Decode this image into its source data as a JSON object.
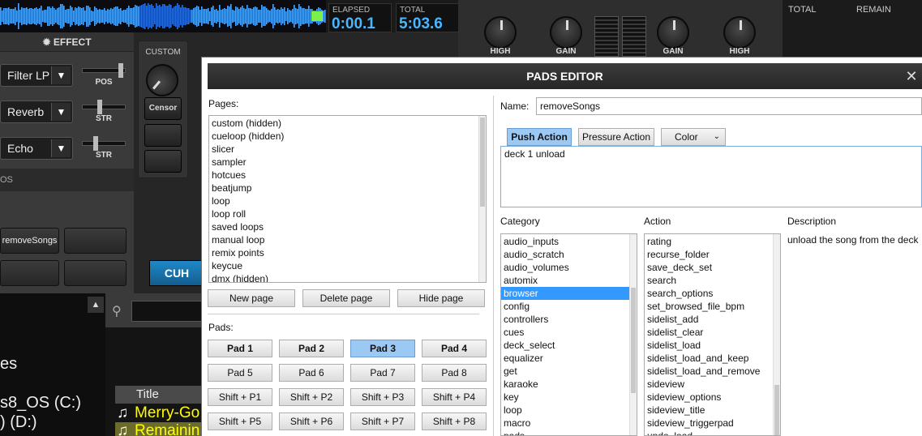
{
  "deck": {
    "elapsed_label": "ELAPSED",
    "elapsed": "0:00.1",
    "total_label": "TOTAL",
    "total": "5:03.6",
    "eq_knobs": [
      "HIGH",
      "GAIN",
      "GAIN",
      "HIGH"
    ],
    "right_total_label": "TOTAL",
    "right_remain_label": "REMAIN"
  },
  "effects": {
    "header": "EFFECT",
    "items": [
      {
        "name": "Filter LP",
        "slider_label": "POS",
        "level": 0.95
      },
      {
        "name": "Reverb",
        "slider_label": "STR",
        "level": 0.4
      },
      {
        "name": "Echo",
        "slider_label": "STR",
        "level": 0.28
      }
    ],
    "section_label": "OS"
  },
  "custom": {
    "label": "CUSTOM",
    "censor": "Censor"
  },
  "pad_buttons": [
    "removeSongs"
  ],
  "cue_button": "CUH",
  "browser": {
    "left_items": [
      "es",
      "s8_OS (C:)",
      ") (D:)"
    ],
    "title_header": "Title",
    "songs": [
      "Merry-Go",
      "Remainin"
    ],
    "scroll_up": "▲"
  },
  "dialog": {
    "title": "PADS EDITOR",
    "close": "✕",
    "pages_label": "Pages:",
    "pages": [
      "custom (hidden)",
      "cueloop (hidden)",
      "slicer",
      "sampler",
      "hotcues",
      "beatjump",
      "loop",
      "loop roll",
      "saved loops",
      "manual loop",
      "remix points",
      "keycue",
      "dmx (hidden)"
    ],
    "new_page": "New page",
    "delete_page": "Delete page",
    "hide_page": "Hide page",
    "pads_label": "Pads:",
    "pads": [
      "Pad 1",
      "Pad 2",
      "Pad 3",
      "Pad 4",
      "Pad 5",
      "Pad 6",
      "Pad 7",
      "Pad 8",
      "Shift + P1",
      "Shift + P2",
      "Shift + P3",
      "Shift + P4",
      "Shift + P5",
      "Shift + P6",
      "Shift + P7",
      "Shift + P8"
    ],
    "selected_pad": "Pad 3",
    "name_label": "Name:",
    "name_value": "removeSongs",
    "tabs": [
      "Push Action",
      "Pressure Action",
      "Color"
    ],
    "active_tab": "Push Action",
    "action_script": "deck 1 unload",
    "category_label": "Category",
    "categories": [
      "audio_inputs",
      "audio_scratch",
      "audio_volumes",
      "automix",
      "browser",
      "config",
      "controllers",
      "cues",
      "deck_select",
      "equalizer",
      "get",
      "karaoke",
      "key",
      "loop",
      "macro",
      "pads"
    ],
    "selected_category": "browser",
    "action_label": "Action",
    "actions": [
      "rating",
      "recurse_folder",
      "save_deck_set",
      "search",
      "search_options",
      "set_browsed_file_bpm",
      "sidelist_add",
      "sidelist_clear",
      "sidelist_load",
      "sidelist_load_and_keep",
      "sidelist_load_and_remove",
      "sideview",
      "sideview_options",
      "sideview_title",
      "sideview_triggerpad",
      "undo_load"
    ],
    "description_label": "Description",
    "description": "unload the song from the deck"
  }
}
